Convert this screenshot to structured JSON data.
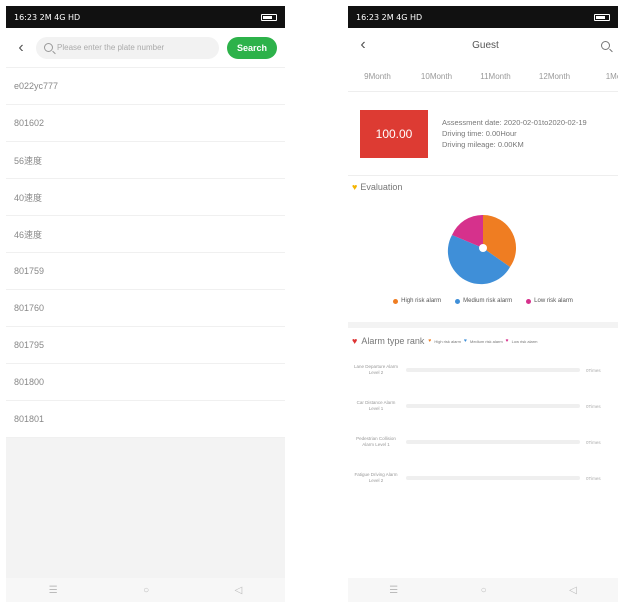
{
  "left": {
    "status_time": "16:23 2M 4G HD",
    "search": {
      "placeholder": "Please enter the plate number",
      "button": "Search"
    },
    "plates": [
      "e022yc777",
      "801602",
      "56速度",
      "40速度",
      "46速度",
      "801759",
      "801760",
      "801795",
      "801800",
      "801801"
    ]
  },
  "right": {
    "status_time": "16:23 2M 4G HD",
    "title": "Guest",
    "months": [
      "9Month",
      "10Month",
      "11Month",
      "12Month",
      "1Mo"
    ],
    "score": "100.00",
    "assessment_date": "Assessment date: 2020-02-01to2020-02-19",
    "driving_time": "Driving time: 0.00Hour",
    "driving_mileage": "Driving mileage: 0.00KM",
    "evaluation_title": "Evaluation",
    "pie_legend": {
      "high": "High risk alarm",
      "medium": "Medium risk alarm",
      "low": "Low risk alarm"
    },
    "alarm_rank_title": "Alarm type rank",
    "mini_legend": {
      "high": "High risk alarm",
      "medium": "Medium risk alarm",
      "low": "Low risk alarm"
    },
    "alarm_rows": [
      {
        "label": "Lane Departure Alarm Level 2",
        "value": "0Times"
      },
      {
        "label": "Car Distance Alarm Level 1",
        "value": "0Times"
      },
      {
        "label": "Pedestrian Collision Alarm Level 1",
        "value": "0Times"
      },
      {
        "label": "Fatigue Driving Alarm Level 2",
        "value": "0Times"
      }
    ],
    "colors": {
      "score_bg": "#dd3b33",
      "pie_orange": "#ef7d22",
      "pie_blue": "#3f8fd8",
      "pie_pink": "#d6318c",
      "search_green": "#2db24a"
    }
  }
}
